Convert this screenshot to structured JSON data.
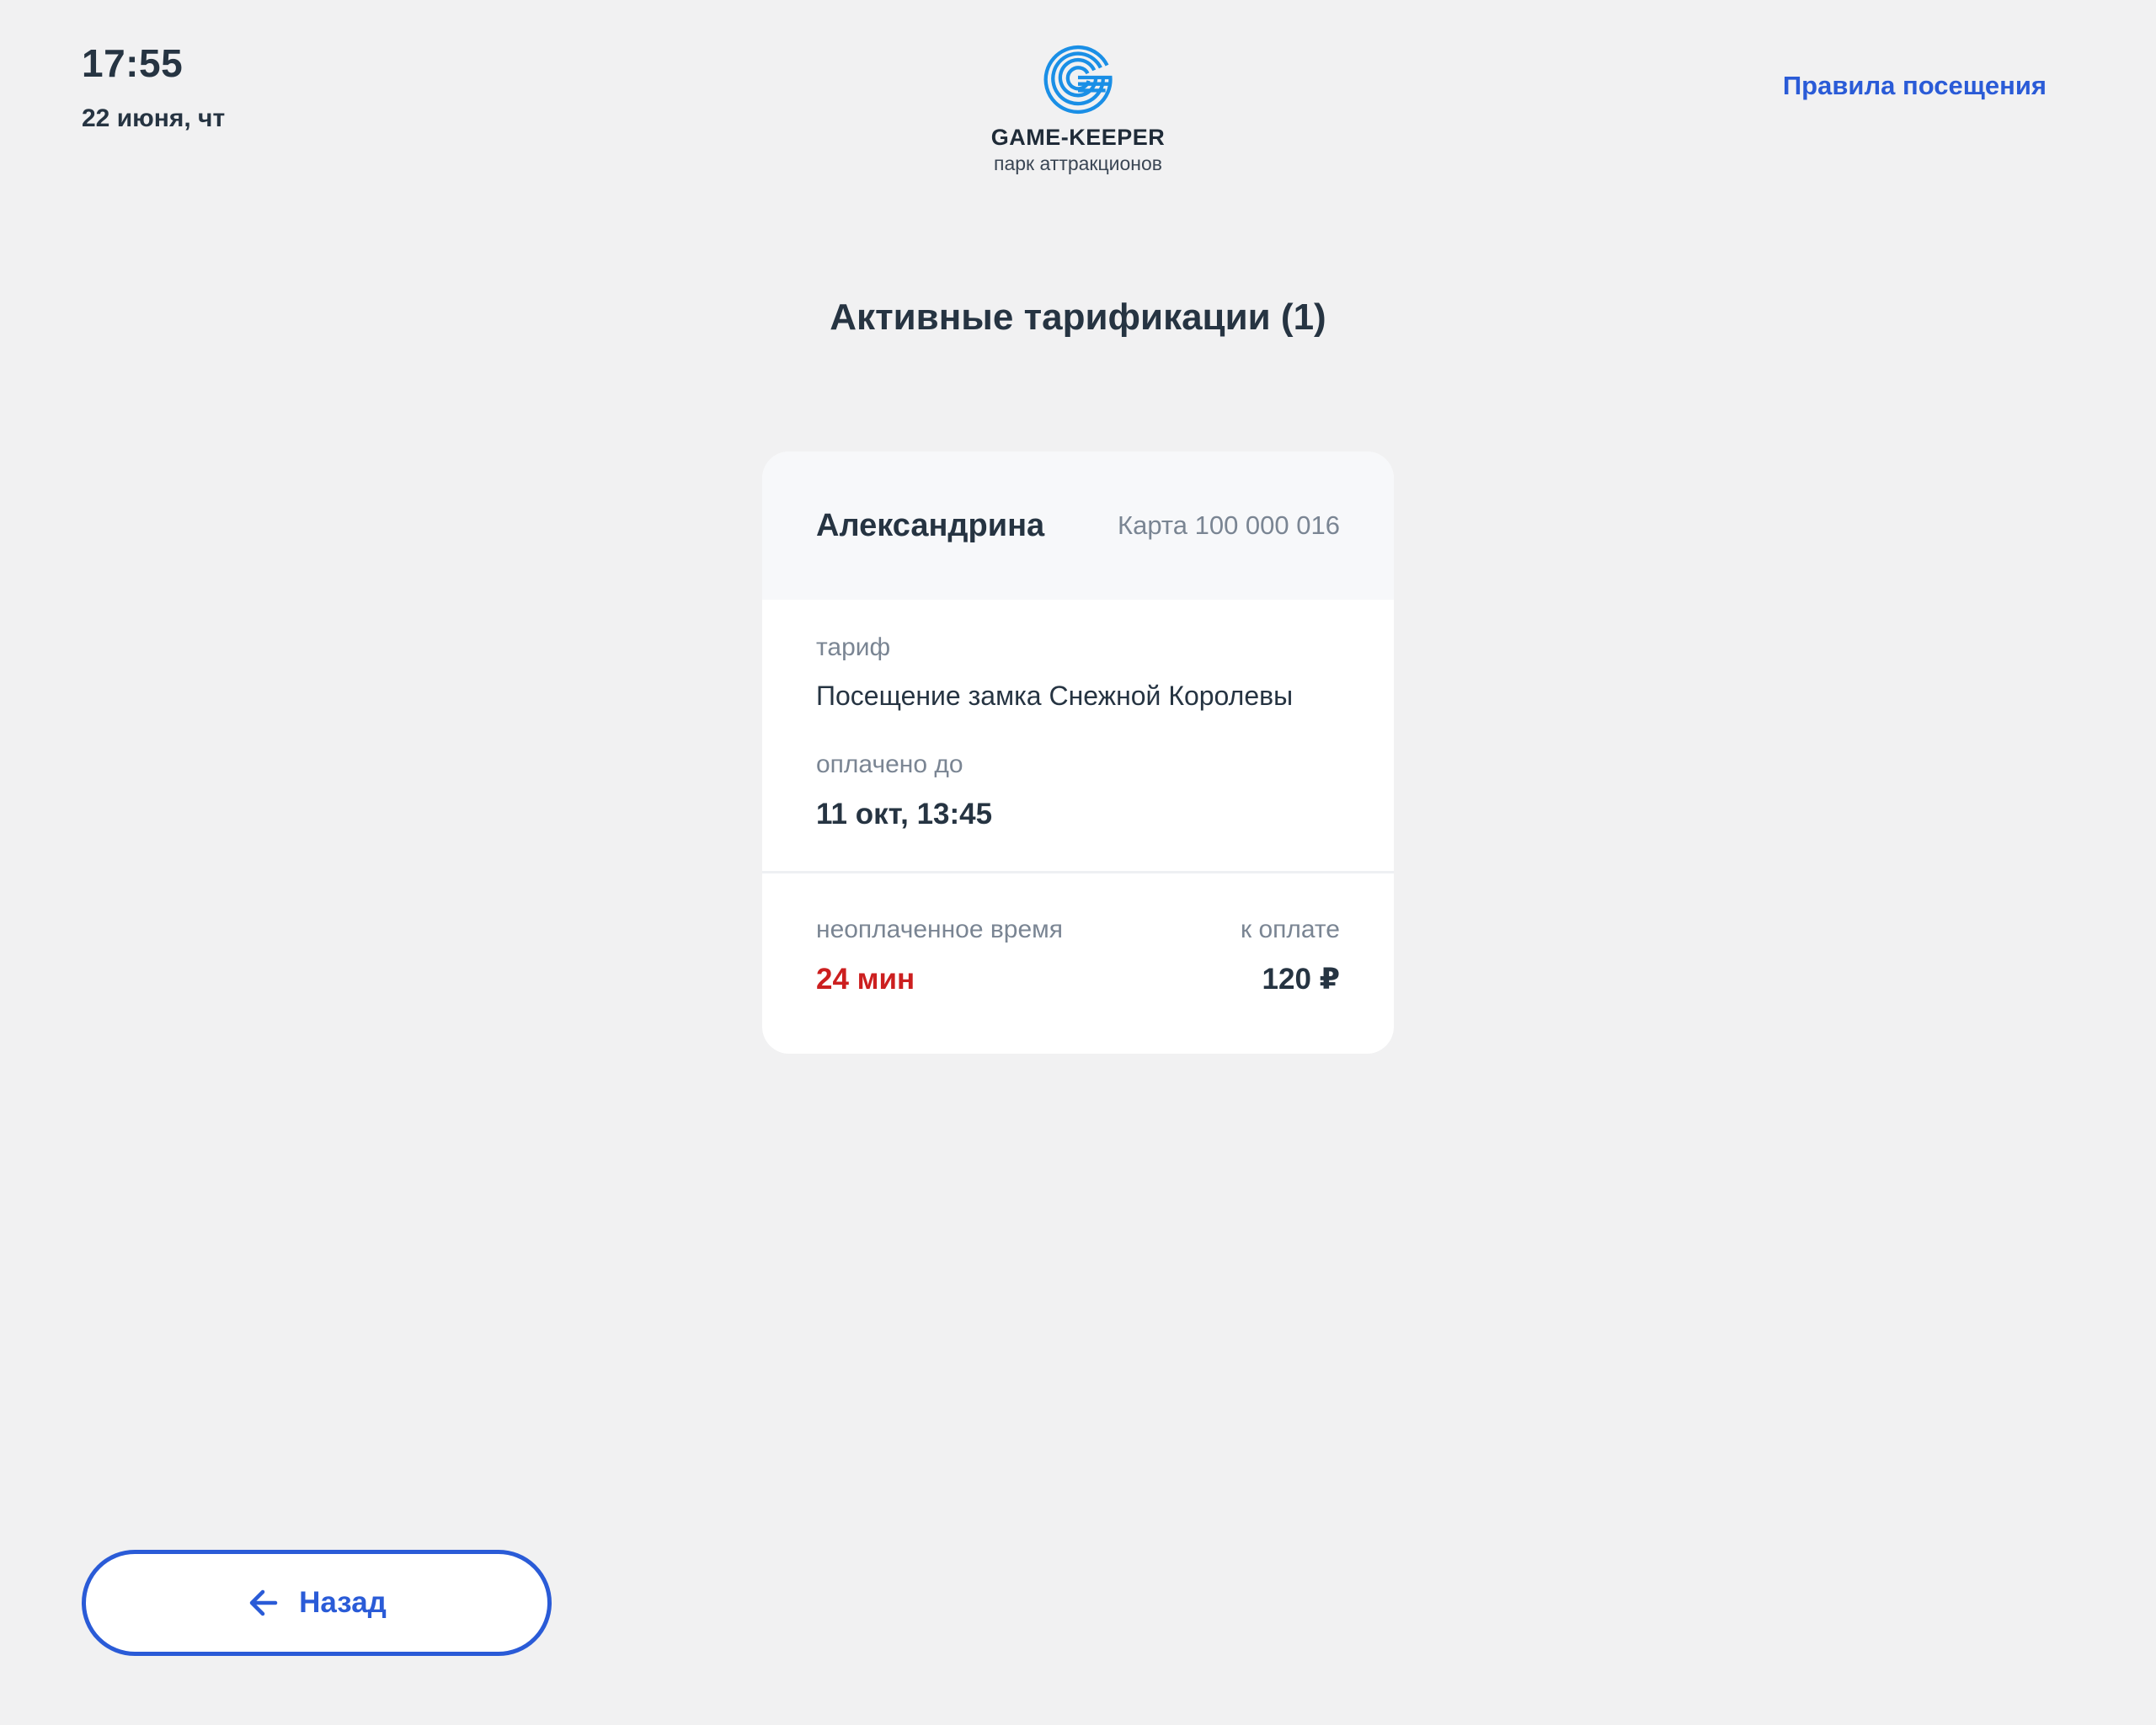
{
  "header": {
    "time": "17:55",
    "date": "22 июня, чт",
    "logo": {
      "name": "GAME-KEEPER",
      "subtitle": "парк аттракционов",
      "icon": "logo-g-icon"
    },
    "rules_link": "Правила посещения"
  },
  "title": "Активные тарификации (1)",
  "card": {
    "name": "Александрина",
    "card_number": "Карта 100 000 016",
    "tariff_label": "тариф",
    "tariff_value": "Посещение замка Снежной Королевы",
    "paid_until_label": "оплачено до",
    "paid_until_value": "11 окт, 13:45",
    "unpaid_time_label": "неоплаченное время",
    "unpaid_time_value": "24 мин",
    "to_pay_label": "к оплате",
    "to_pay_value": "120 ₽"
  },
  "back_button": {
    "label": "Назад",
    "icon": "arrow-left-icon"
  },
  "colors": {
    "background": "#f1f1f2",
    "accent": "#2a5bd7",
    "logo_blue": "#1a8fe6",
    "text": "#263442",
    "muted": "#7a8593",
    "danger": "#cc1f1f"
  }
}
